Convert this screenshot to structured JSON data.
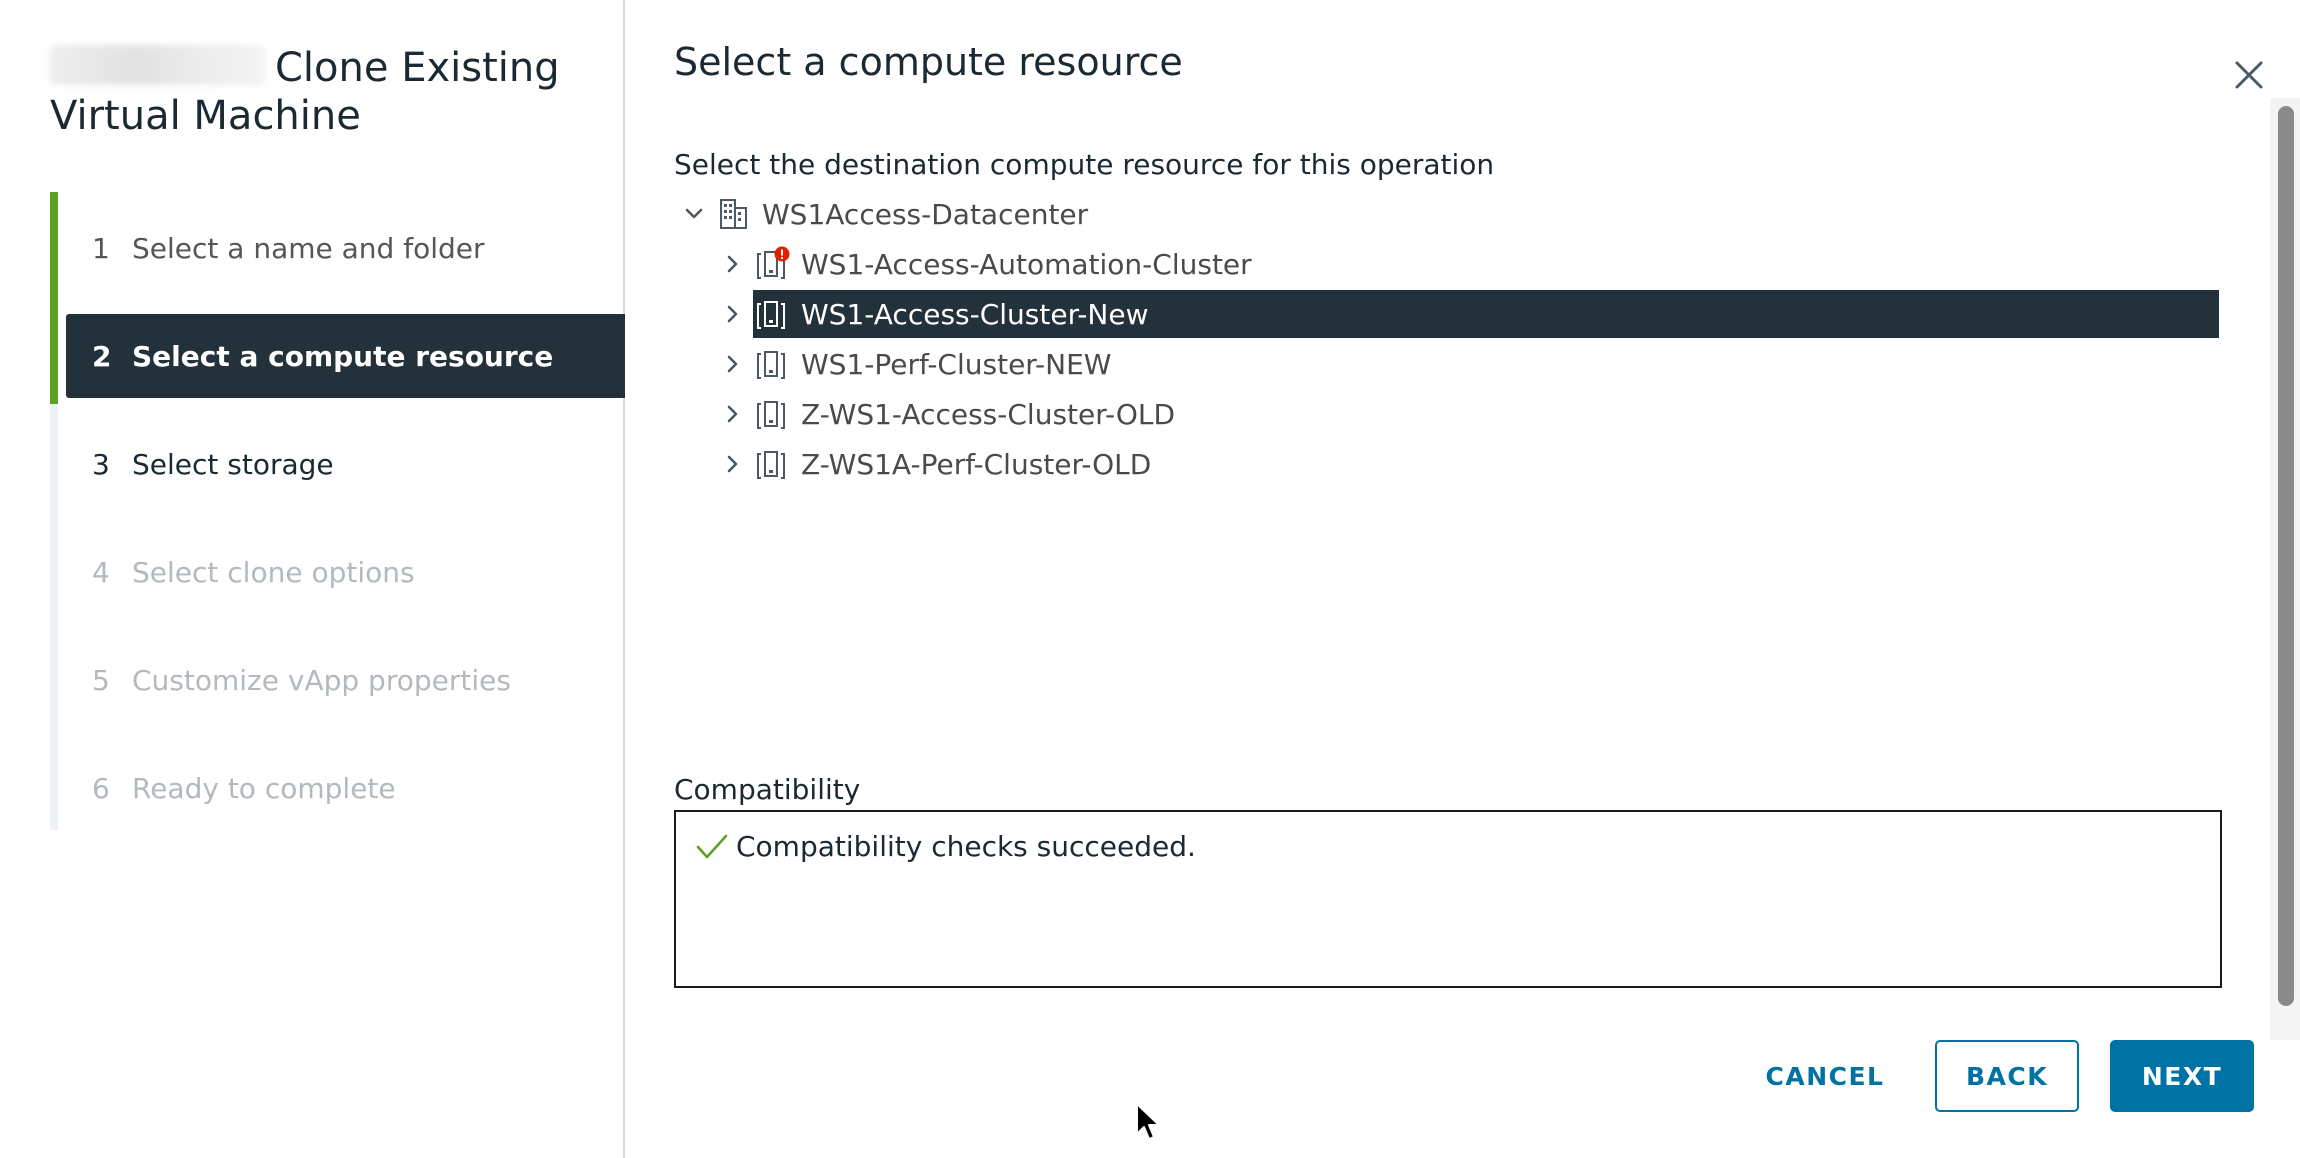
{
  "wizard": {
    "title": "Clone Existing Virtual Machine",
    "steps": [
      {
        "num": "1",
        "label": "Select a name and folder"
      },
      {
        "num": "2",
        "label": "Select a compute resource"
      },
      {
        "num": "3",
        "label": "Select storage"
      },
      {
        "num": "4",
        "label": "Select clone options"
      },
      {
        "num": "5",
        "label": "Customize vApp properties"
      },
      {
        "num": "6",
        "label": "Ready to complete"
      }
    ]
  },
  "page": {
    "title": "Select a compute resource",
    "instruction": "Select the destination compute resource for this operation"
  },
  "tree": {
    "datacenter": {
      "label": "WS1Access-Datacenter",
      "icon": "datacenter-icon"
    },
    "clusters": [
      {
        "label": "WS1-Access-Automation-Cluster",
        "icon": "cluster-warning-icon"
      },
      {
        "label": "WS1-Access-Cluster-New",
        "icon": "cluster-icon",
        "selected": true
      },
      {
        "label": "WS1-Perf-Cluster-NEW",
        "icon": "cluster-icon"
      },
      {
        "label": "Z-WS1-Access-Cluster-OLD",
        "icon": "cluster-icon"
      },
      {
        "label": "Z-WS1A-Perf-Cluster-OLD",
        "icon": "cluster-icon"
      }
    ]
  },
  "compatibility": {
    "label": "Compatibility",
    "message": "Compatibility checks succeeded."
  },
  "buttons": {
    "cancel": "CANCEL",
    "back": "BACK",
    "next": "NEXT"
  },
  "colors": {
    "accent": "#0072a3",
    "selected_bg": "#23313b",
    "progress": "#5aa220",
    "error": "#e12200",
    "success": "#5aa220"
  }
}
